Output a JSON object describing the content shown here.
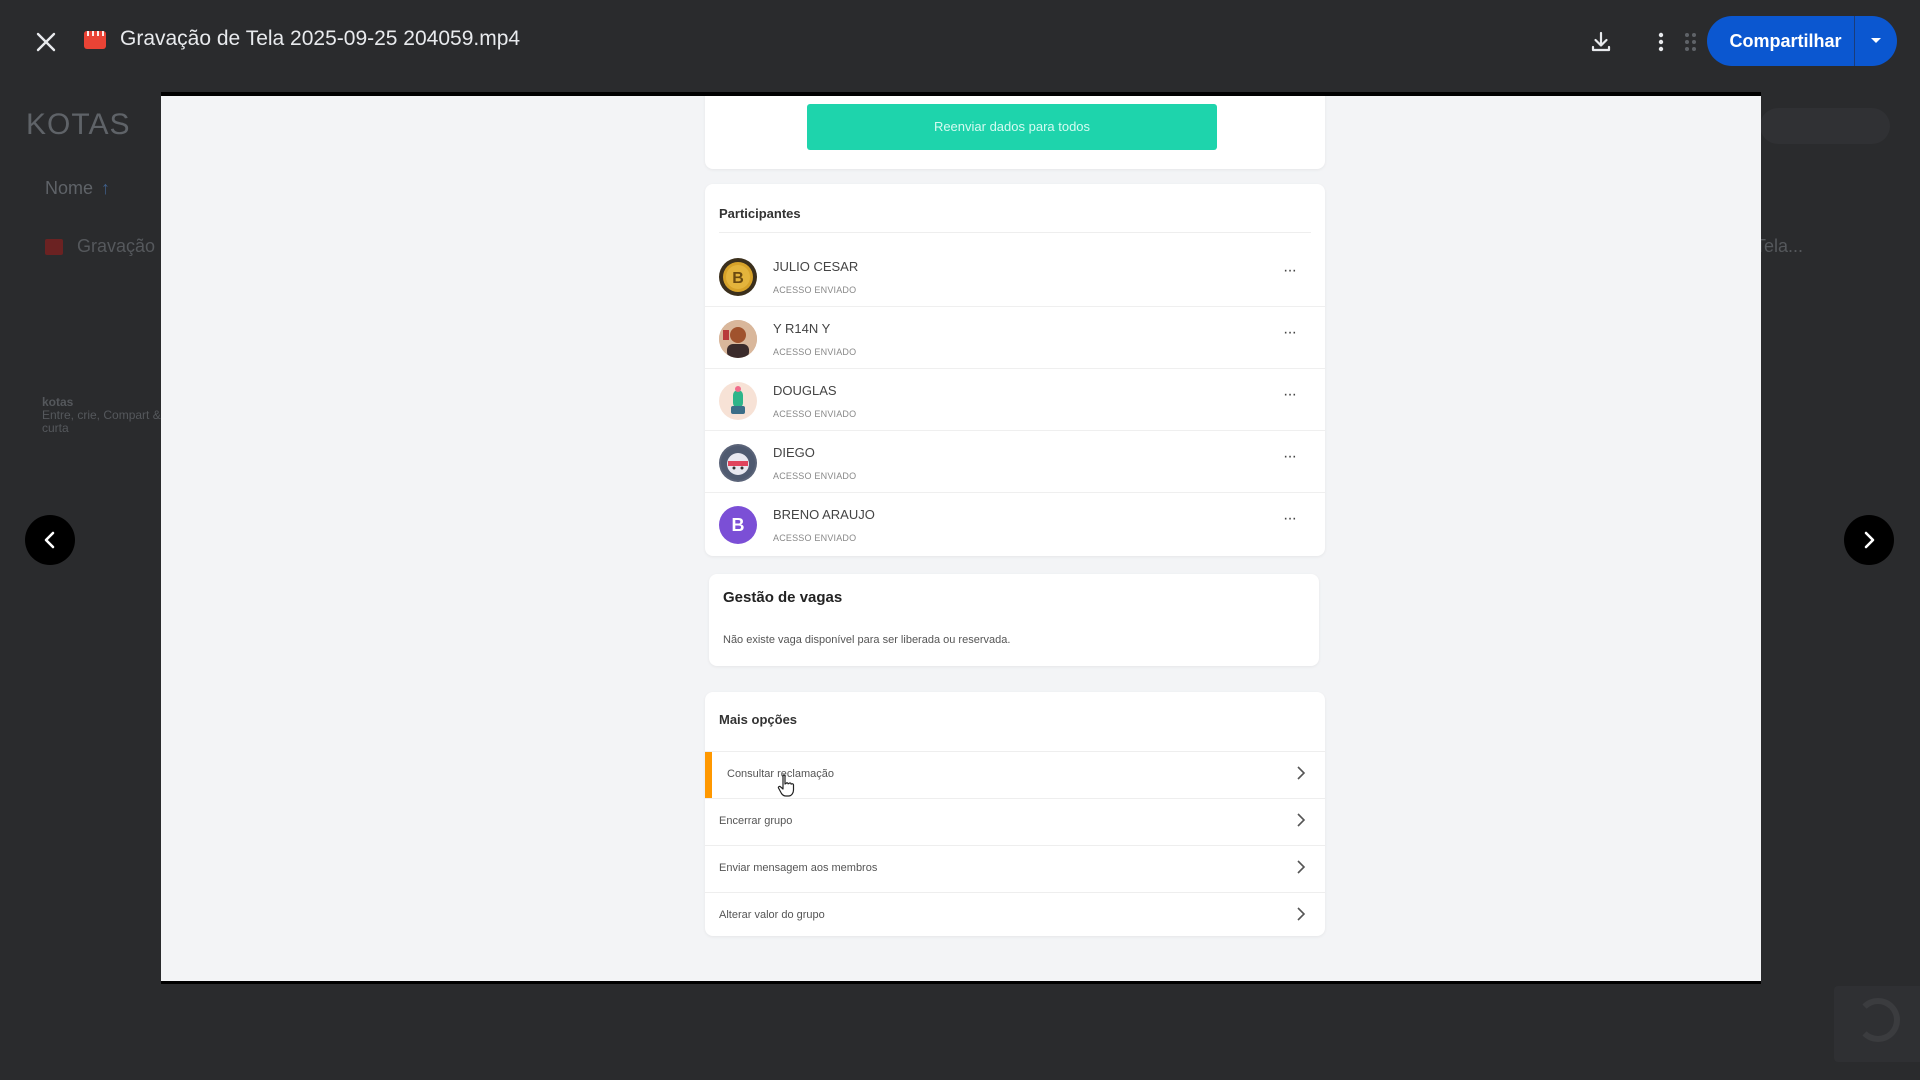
{
  "viewer": {
    "file_title": "Gravação de Tela 2025-09-25 204059.mp4",
    "share_label": "Compartilhar"
  },
  "background": {
    "folder_title": "KOTAS",
    "sort_label": "Nome",
    "file_name_left": "Gravação",
    "file_name_right": "Tela...",
    "kotas_name": "kotas",
    "kotas_tagline": "Entre, crie, Compart & curta"
  },
  "app": {
    "resend_button": "Reenviar dados para todos",
    "participants_heading": "Participantes",
    "participants": [
      {
        "name": "JULIO CESAR",
        "status": "ACESSO ENVIADO",
        "avatar": "bitcoin-avatar"
      },
      {
        "name": "Y R14N Y",
        "status": "ACESSO ENVIADO",
        "avatar": "photo-avatar"
      },
      {
        "name": "DOUGLAS",
        "status": "ACESSO ENVIADO",
        "avatar": "cactus-avatar"
      },
      {
        "name": "DIEGO",
        "status": "ACESSO ENVIADO",
        "avatar": "character-avatar"
      },
      {
        "name": "BRENO ARAUJO",
        "status": "ACESSO ENVIADO",
        "avatar": "letter-avatar",
        "initial": "B"
      }
    ],
    "menu_glyph": "···",
    "gestao_title": "Gestão de vagas",
    "gestao_text": "Não existe vaga disponível para ser liberada ou reservada.",
    "more_heading": "Mais opções",
    "options": [
      "Consultar reclamação",
      "Encerrar grupo",
      "Enviar mensagem aos membros",
      "Alterar valor do grupo"
    ]
  },
  "colors": {
    "share_blue": "#0b57d0",
    "resend_teal": "#1ed4ac",
    "active_orange": "#ff9800",
    "breno_purple": "#7b4fd6"
  }
}
